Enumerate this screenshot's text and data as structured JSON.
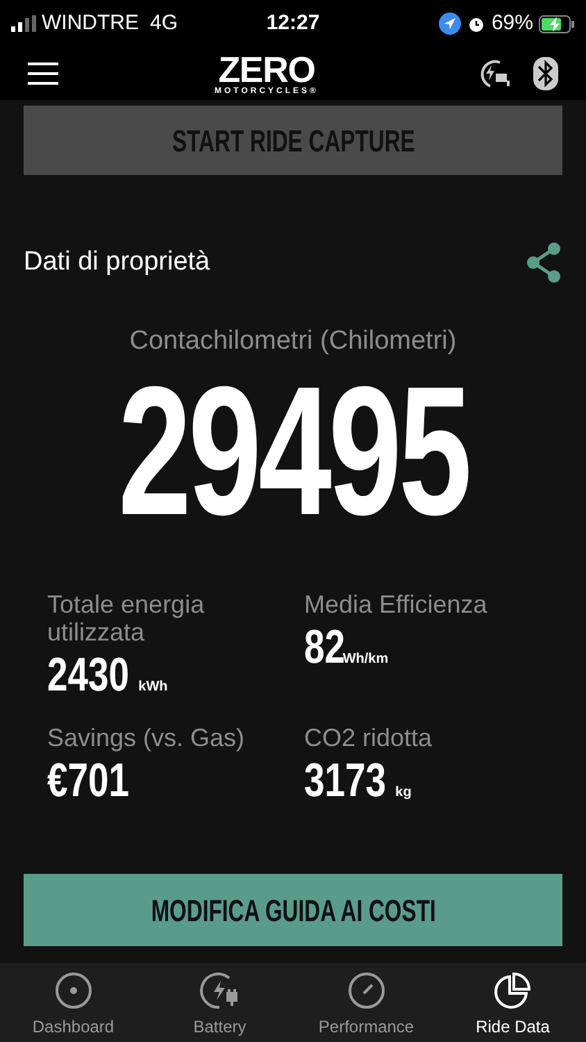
{
  "status_bar": {
    "carrier": "WINDTRE",
    "network": "4G",
    "time": "12:27",
    "battery": "69%"
  },
  "header": {
    "logo": "ZERO",
    "logo_sub": "MOTORCYCLES®"
  },
  "top_button": {
    "label": "START RIDE CAPTURE"
  },
  "section": {
    "title": "Dati di proprietà"
  },
  "odometer": {
    "label": "Contachilometri (Chilometri)",
    "value": "29495"
  },
  "stats": [
    {
      "label": "Totale energia utilizzata",
      "value": "2430",
      "unit": "kWh"
    },
    {
      "label": "Media Efficienza",
      "value": "82",
      "unit": "Wh/km"
    },
    {
      "label": "Savings (vs. Gas)",
      "value": "€701"
    },
    {
      "label": "CO2 ridotta",
      "value": "3173",
      "unit": "kg"
    }
  ],
  "bottom_button": {
    "label": "MODIFICA GUIDA AI COSTI"
  },
  "tabs": [
    {
      "label": "Dashboard",
      "kind": "dashboard",
      "selected": false
    },
    {
      "label": "Battery",
      "kind": "battery",
      "selected": false
    },
    {
      "label": "Performance",
      "kind": "performance",
      "selected": false
    },
    {
      "label": "Ride Data",
      "kind": "ride",
      "selected": true
    }
  ]
}
